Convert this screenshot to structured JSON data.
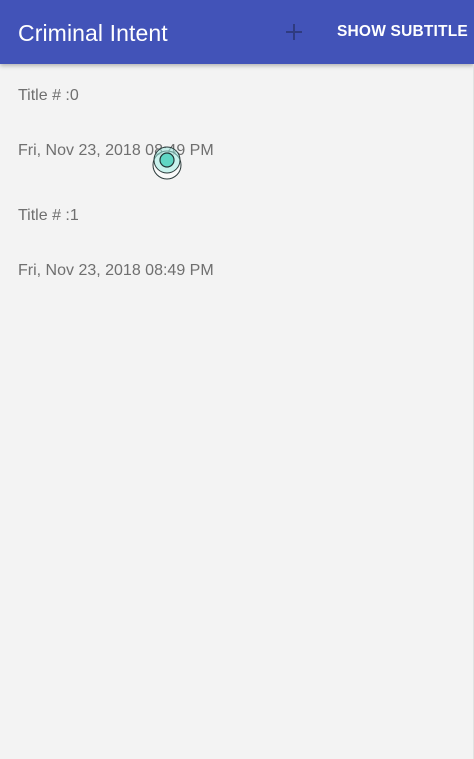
{
  "app_bar": {
    "title": "Criminal Intent",
    "add_icon": "plus-icon",
    "show_subtitle_label": "SHOW SUBTITLE"
  },
  "crimes": [
    {
      "title": "Title # :0",
      "date": "Fri, Nov 23, 2018 08:49 PM"
    },
    {
      "title": "Title # :1",
      "date": "Fri, Nov 23, 2018 08:49 PM"
    }
  ],
  "colors": {
    "app_bar": "#4253b8",
    "background": "#f3f3f3",
    "list_text": "#6f6f6f",
    "touch_indicator": "#5fd6c4"
  }
}
